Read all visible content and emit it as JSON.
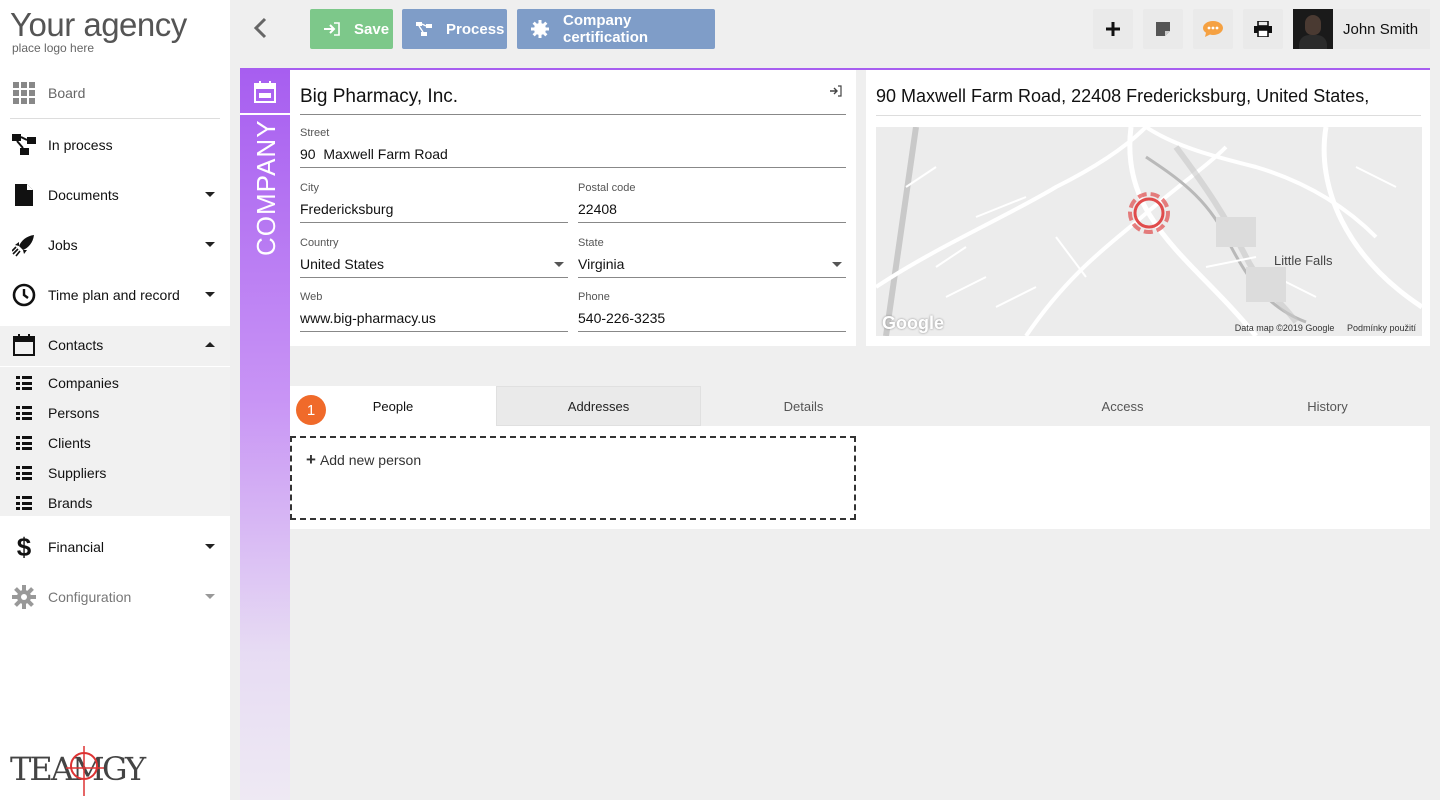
{
  "brand": {
    "logo_title": "Your agency",
    "logo_subtitle": "place logo here",
    "footer_logo_left": "TEAM",
    "footer_logo_right": "GY"
  },
  "sidebar": {
    "items": [
      {
        "label": "Board",
        "icon": "grid-icon"
      },
      {
        "label": "In process",
        "icon": "process-icon"
      },
      {
        "label": "Documents",
        "icon": "document-icon"
      },
      {
        "label": "Jobs",
        "icon": "rocket-icon"
      },
      {
        "label": "Time plan and record",
        "icon": "clock-icon"
      },
      {
        "label": "Contacts",
        "icon": "calendar-icon"
      },
      {
        "label": "Financial",
        "icon": "dollar-icon"
      },
      {
        "label": "Configuration",
        "icon": "gear-icon"
      }
    ],
    "contacts_sub": [
      "Companies",
      "Persons",
      "Clients",
      "Suppliers",
      "Brands"
    ]
  },
  "toolbar": {
    "save_label": "Save",
    "process_label": "Process",
    "cert_label": "Company certification",
    "user_name": "John Smith"
  },
  "entity": {
    "type_label": "COMPANY",
    "accent_color": "#a75ef0"
  },
  "company": {
    "name": "Big Pharmacy, Inc.",
    "street_label": "Street",
    "street": "90  Maxwell Farm Road",
    "city_label": "City",
    "city": "Fredericksburg",
    "postal_label": "Postal code",
    "postal": "22408",
    "country_label": "Country",
    "country": "United States",
    "state_label": "State",
    "state": "Virginia",
    "web_label": "Web",
    "web": "www.big-pharmacy.us",
    "phone_label": "Phone",
    "phone": "540-226-3235"
  },
  "map": {
    "address": "90 Maxwell Farm Road, 22408 Fredericksburg, United States,",
    "place_label": "Little Falls",
    "google": "Google",
    "attribution": "Data map ©2019 Google",
    "terms": "Podmínky použití"
  },
  "tabs": [
    {
      "label": "People",
      "badge": "1"
    },
    {
      "label": "Addresses"
    },
    {
      "label": "Details"
    },
    {
      "label": "Access"
    },
    {
      "label": "History"
    }
  ],
  "people": {
    "add_label": "Add new person"
  }
}
